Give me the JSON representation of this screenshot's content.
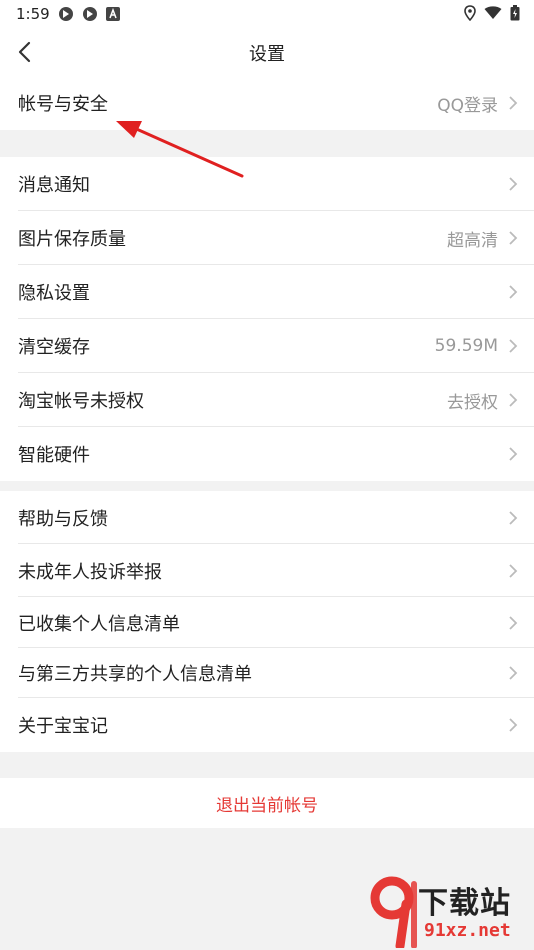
{
  "status_bar": {
    "time": "1:59"
  },
  "header": {
    "title": "设置"
  },
  "group1": [
    {
      "label": "帐号与安全",
      "value": "QQ登录"
    }
  ],
  "group2": [
    {
      "label": "消息通知",
      "value": ""
    },
    {
      "label": "图片保存质量",
      "value": "超高清"
    },
    {
      "label": "隐私设置",
      "value": ""
    },
    {
      "label": "清空缓存",
      "value": "59.59M"
    },
    {
      "label": "淘宝帐号未授权",
      "value": "去授权"
    },
    {
      "label": "智能硬件",
      "value": ""
    }
  ],
  "group3": [
    {
      "label": "帮助与反馈",
      "value": ""
    },
    {
      "label": "未成年人投诉举报",
      "value": ""
    },
    {
      "label": "已收集个人信息清单",
      "value": ""
    },
    {
      "label": "与第三方共享的个人信息清单",
      "value": ""
    },
    {
      "label": "关于宝宝记",
      "value": ""
    }
  ],
  "logout": {
    "label": "退出当前帐号"
  },
  "watermark": {
    "top": "下载站",
    "bottom": "91xz.net"
  },
  "colors": {
    "accent_red": "#e53935",
    "annotation_arrow": "#e02020"
  }
}
